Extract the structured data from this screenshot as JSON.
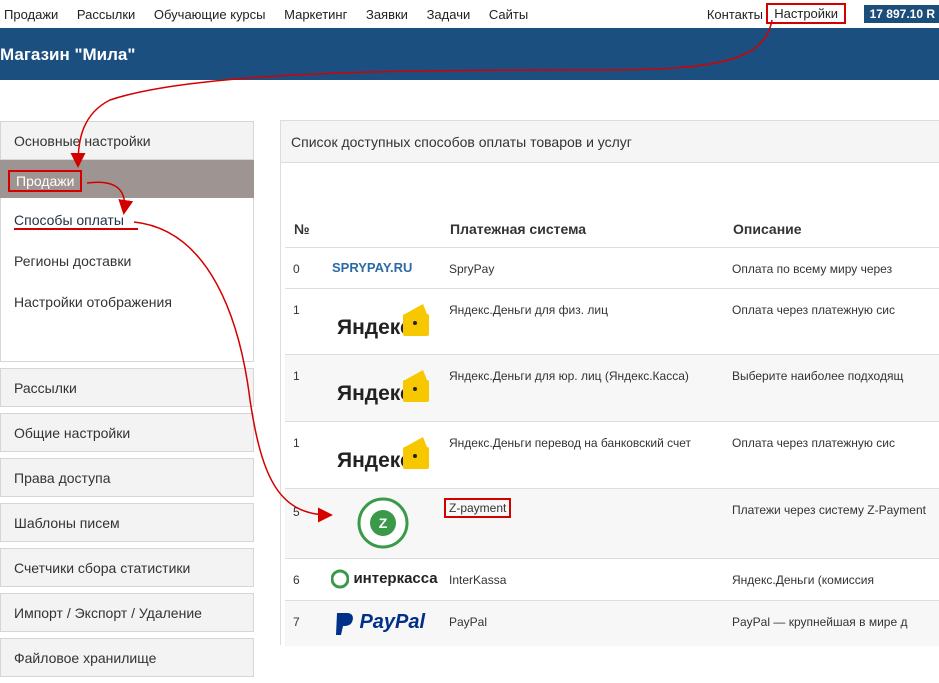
{
  "topnav": {
    "items": [
      "Продажи",
      "Рассылки",
      "Обучающие курсы",
      "Маркетинг",
      "Заявки",
      "Задачи",
      "Сайты"
    ],
    "contacts": "Контакты",
    "settings": "Настройки",
    "balance": "17 897.10 R"
  },
  "header": {
    "title": "Магазин \"Мила\""
  },
  "sidebar": {
    "top": "Основные настройки",
    "active": "Продажи",
    "sub": [
      "Способы оплаты",
      "Регионы доставки",
      "Настройки отображения"
    ],
    "items": [
      "Рассылки",
      "Общие настройки",
      "Права доступа",
      "Шаблоны писем",
      "Счетчики сбора статистики",
      "Импорт / Экспорт / Удаление",
      "Файловое хранилище"
    ]
  },
  "panel": {
    "title": "Список доступных способов оплаты товаров и услуг",
    "headers": {
      "num": "№",
      "system": "Платежная система",
      "desc": "Описание"
    },
    "rows": [
      {
        "num": "0",
        "name": "SpryPay",
        "desc": "Оплата по всему миру через",
        "logo": "SPRYPAY.RU"
      },
      {
        "num": "1",
        "name": "Яндекс.Деньги для физ. лиц",
        "desc": "Оплата через платежную сис",
        "logo": "Яндекс"
      },
      {
        "num": "1",
        "name": "Яндекс.Деньги для юр. лиц (Яндекс.Касса)",
        "desc": "Выберите наиболее подходящ",
        "logo": "Яндекс"
      },
      {
        "num": "1",
        "name": "Яндекс.Деньги перевод на банковский счет",
        "desc": "Оплата через платежную сис",
        "logo": "Яндекс"
      },
      {
        "num": "5",
        "name": "Z-payment",
        "desc": "Платежи через систему Z-Payment",
        "logo": "Z"
      },
      {
        "num": "6",
        "name": "InterKassa",
        "desc": "Яндекс.Деньги (комиссия",
        "logo": "интеркасса"
      },
      {
        "num": "7",
        "name": "PayPal",
        "desc": "PayPal — крупнейшая в мире д",
        "logo": "PayPal"
      }
    ]
  },
  "colors": {
    "accent": "#1b4f80",
    "highlight": "#d40000"
  }
}
